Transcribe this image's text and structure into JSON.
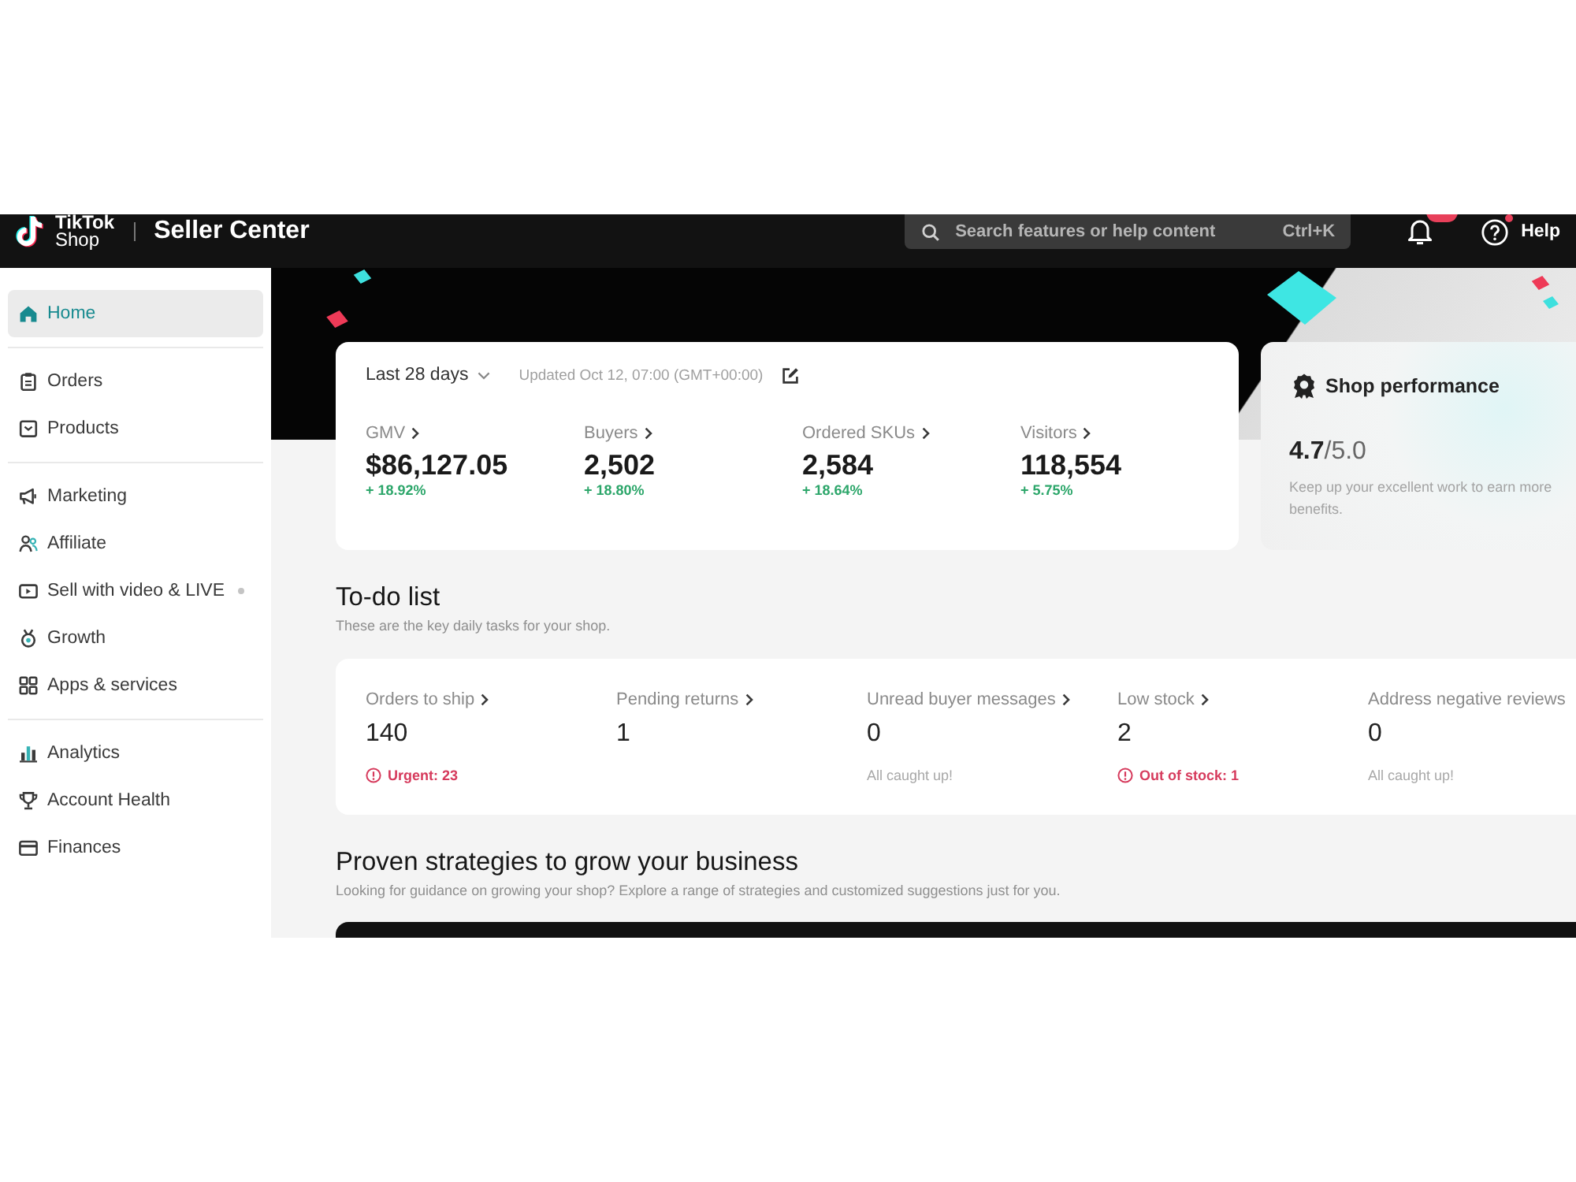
{
  "top_bar": {
    "logo": {
      "line_1": "TikTok",
      "line_2": "Shop"
    },
    "title": "Seller Center",
    "search": {
      "placeholder": "Search features or help content",
      "shortcut": "Ctrl+K"
    },
    "notifications": {
      "badge": true
    },
    "help": {
      "label": "Help",
      "dot": true
    }
  },
  "sidebar": {
    "groups": [
      {
        "items": [
          {
            "label": "Home",
            "selected": true,
            "dot": false
          }
        ]
      },
      {
        "items": [
          {
            "label": "Orders",
            "selected": false,
            "dot": false
          },
          {
            "label": "Products",
            "selected": false,
            "dot": false
          }
        ]
      },
      {
        "items": [
          {
            "label": "Marketing",
            "selected": false,
            "dot": false
          },
          {
            "label": "Affiliate",
            "selected": false,
            "dot": false
          },
          {
            "label": "Sell with video & LIVE",
            "selected": false,
            "dot": true
          },
          {
            "label": "Growth",
            "selected": false,
            "dot": false
          },
          {
            "label": "Apps & services",
            "selected": false,
            "dot": false
          }
        ]
      },
      {
        "items": [
          {
            "label": "Analytics",
            "selected": false,
            "dot": false
          },
          {
            "label": "Account Health",
            "selected": false,
            "dot": false
          },
          {
            "label": "Finances",
            "selected": false,
            "dot": false
          }
        ]
      }
    ]
  },
  "summary": {
    "period": "Last 28 days",
    "updated": "Updated Oct 12, 07:00 (GMT+00:00)",
    "metrics": [
      {
        "label": "GMV",
        "value": "$86,127.05",
        "change": "+ 18.92%"
      },
      {
        "label": "Buyers",
        "value": "2,502",
        "change": "+ 18.80%"
      },
      {
        "label": "Ordered SKUs",
        "value": "2,584",
        "change": "+ 18.64%"
      },
      {
        "label": "Visitors",
        "value": "118,554",
        "change": "+ 5.75%"
      }
    ]
  },
  "shop_performance": {
    "title": "Shop performance",
    "score": "**4.7**/5.0",
    "message": "Keep up your excellent work to earn more benefits."
  },
  "todo": {
    "title": "To-do list",
    "subtitle": "These are the key daily tasks for your shop.",
    "items": [
      {
        "label": "Orders to ship",
        "chevron": true,
        "value": "140",
        "note": {
          "text": "Urgent: 23",
          "kind": "alert"
        }
      },
      {
        "label": "Pending returns",
        "chevron": true,
        "value": "1"
      },
      {
        "label": "Unread buyer messages",
        "chevron": true,
        "value": "0",
        "note": {
          "text": "All caught up!",
          "kind": "info"
        }
      },
      {
        "label": "Low stock",
        "chevron": true,
        "value": "2",
        "note": {
          "text": "Out of stock: 1",
          "kind": "alert"
        }
      },
      {
        "label": "Address negative reviews",
        "chevron": false,
        "value": "0",
        "note": {
          "text": "All caught up!",
          "kind": "info"
        }
      }
    ]
  },
  "strategies": {
    "title": "Proven strategies to grow your business",
    "subtitle": "Looking for guidance on growing your shop? Explore a range of strategies and customized suggestions just for you."
  }
}
